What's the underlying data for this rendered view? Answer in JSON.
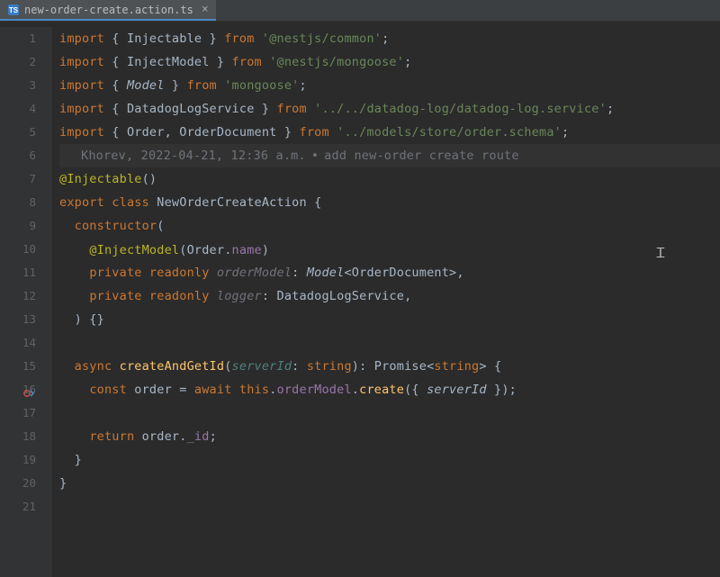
{
  "tab": {
    "filename": "new-order-create.action.ts",
    "icon": "ts-file-icon"
  },
  "blame": {
    "author": "Khorev",
    "timestamp": "2022-04-21, 12:36 a.m.",
    "message": "add new-order create route"
  },
  "highlighted_line": 6,
  "cursor_line": 10,
  "gutter_mark_line": 16,
  "lines": {
    "1": {
      "t": [
        [
          "kw",
          "import "
        ],
        [
          "punc",
          "{ Injectable } "
        ],
        [
          "kw",
          "from "
        ],
        [
          "str",
          "'@nestjs/common'"
        ],
        [
          "punc",
          ";"
        ]
      ]
    },
    "2": {
      "t": [
        [
          "kw",
          "import "
        ],
        [
          "punc",
          "{ InjectModel } "
        ],
        [
          "kw",
          "from "
        ],
        [
          "str",
          "'@nestjs/mongoose'"
        ],
        [
          "punc",
          ";"
        ]
      ]
    },
    "3": {
      "t": [
        [
          "kw",
          "import "
        ],
        [
          "punc",
          "{ "
        ],
        [
          "type",
          "Model"
        ],
        [
          "punc",
          " } "
        ],
        [
          "kw",
          "from "
        ],
        [
          "str",
          "'mongoose'"
        ],
        [
          "punc",
          ";"
        ]
      ]
    },
    "4": {
      "t": [
        [
          "kw",
          "import "
        ],
        [
          "punc",
          "{ DatadogLogService } "
        ],
        [
          "kw",
          "from "
        ],
        [
          "str",
          "'../../datadog-log/datadog-log.service'"
        ],
        [
          "punc",
          ";"
        ]
      ]
    },
    "5": {
      "t": [
        [
          "kw",
          "import "
        ],
        [
          "punc",
          "{ Order"
        ],
        [
          "punc",
          ", OrderDocument } "
        ],
        [
          "kw",
          "from "
        ],
        [
          "str",
          "'../models/store/order.schema'"
        ],
        [
          "punc",
          ";"
        ]
      ]
    },
    "6": {
      "blame": true
    },
    "7": {
      "t": [
        [
          "dec",
          "@Injectable"
        ],
        [
          "punc",
          "()"
        ]
      ]
    },
    "8": {
      "t": [
        [
          "kw",
          "export class "
        ],
        [
          "cls",
          "NewOrderCreateAction {"
        ]
      ]
    },
    "9": {
      "indent": 1,
      "t": [
        [
          "kw",
          "constructor"
        ],
        [
          "punc",
          "("
        ]
      ]
    },
    "10": {
      "indent": 2,
      "t": [
        [
          "dec",
          "@InjectModel"
        ],
        [
          "punc",
          "(Order."
        ],
        [
          "field",
          "name"
        ],
        [
          "punc",
          ")"
        ]
      ]
    },
    "11": {
      "indent": 2,
      "t": [
        [
          "kw",
          "private readonly "
        ],
        [
          "param",
          "orderModel"
        ],
        [
          "punc",
          ": "
        ],
        [
          "type",
          "Model"
        ],
        [
          "punc",
          "<OrderDocument>,"
        ]
      ]
    },
    "12": {
      "indent": 2,
      "t": [
        [
          "kw",
          "private readonly "
        ],
        [
          "param",
          "logger"
        ],
        [
          "punc",
          ": DatadogLogService,"
        ]
      ]
    },
    "13": {
      "indent": 1,
      "t": [
        [
          "punc",
          ") {}"
        ]
      ]
    },
    "14": {
      "t": []
    },
    "15": {
      "indent": 1,
      "t": [
        [
          "kw",
          "async "
        ],
        [
          "fn",
          "createAndGetId"
        ],
        [
          "punc",
          "("
        ],
        [
          "paramname",
          "serverId"
        ],
        [
          "punc",
          ": "
        ],
        [
          "kw",
          "string"
        ],
        [
          "punc",
          "): Promise<"
        ],
        [
          "kw",
          "string"
        ],
        [
          "punc",
          "> {"
        ]
      ]
    },
    "16": {
      "indent": 2,
      "t": [
        [
          "kw",
          "const "
        ],
        [
          "cls",
          "order = "
        ],
        [
          "kw",
          "await this"
        ],
        [
          "punc",
          "."
        ],
        [
          "field",
          "orderModel"
        ],
        [
          "punc",
          "."
        ],
        [
          "fn",
          "create"
        ],
        [
          "punc",
          "({ "
        ],
        [
          "ital",
          "serverId"
        ],
        [
          "punc",
          " });"
        ]
      ]
    },
    "17": {
      "t": []
    },
    "18": {
      "indent": 2,
      "t": [
        [
          "kw",
          "return "
        ],
        [
          "cls",
          "order."
        ],
        [
          "field",
          "_id"
        ],
        [
          "punc",
          ";"
        ]
      ]
    },
    "19": {
      "indent": 1,
      "t": [
        [
          "punc",
          "}"
        ]
      ]
    },
    "20": {
      "t": [
        [
          "punc",
          "}"
        ]
      ]
    },
    "21": {
      "t": []
    }
  },
  "line_count": 21
}
